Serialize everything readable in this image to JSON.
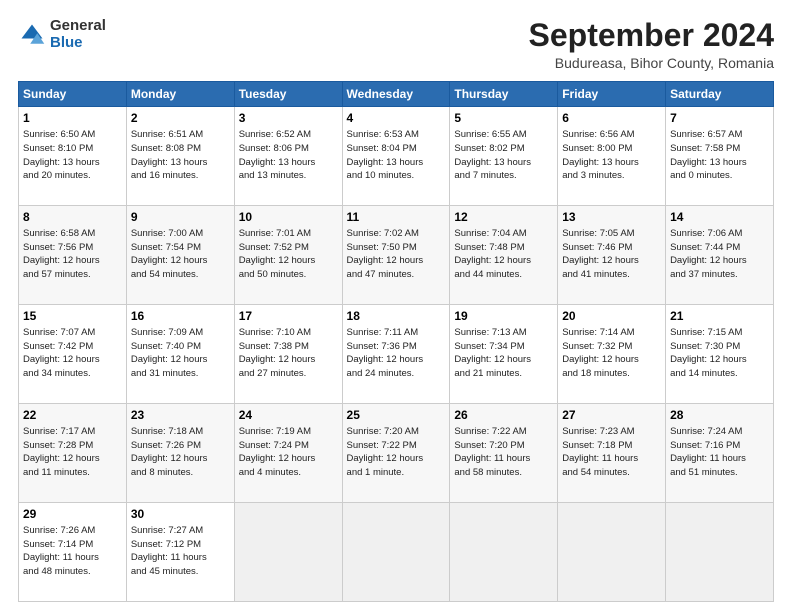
{
  "logo": {
    "general": "General",
    "blue": "Blue"
  },
  "title": "September 2024",
  "subtitle": "Budureasa, Bihor County, Romania",
  "days_header": [
    "Sunday",
    "Monday",
    "Tuesday",
    "Wednesday",
    "Thursday",
    "Friday",
    "Saturday"
  ],
  "weeks": [
    [
      {
        "day": "1",
        "info": "Sunrise: 6:50 AM\nSunset: 8:10 PM\nDaylight: 13 hours\nand 20 minutes."
      },
      {
        "day": "2",
        "info": "Sunrise: 6:51 AM\nSunset: 8:08 PM\nDaylight: 13 hours\nand 16 minutes."
      },
      {
        "day": "3",
        "info": "Sunrise: 6:52 AM\nSunset: 8:06 PM\nDaylight: 13 hours\nand 13 minutes."
      },
      {
        "day": "4",
        "info": "Sunrise: 6:53 AM\nSunset: 8:04 PM\nDaylight: 13 hours\nand 10 minutes."
      },
      {
        "day": "5",
        "info": "Sunrise: 6:55 AM\nSunset: 8:02 PM\nDaylight: 13 hours\nand 7 minutes."
      },
      {
        "day": "6",
        "info": "Sunrise: 6:56 AM\nSunset: 8:00 PM\nDaylight: 13 hours\nand 3 minutes."
      },
      {
        "day": "7",
        "info": "Sunrise: 6:57 AM\nSunset: 7:58 PM\nDaylight: 13 hours\nand 0 minutes."
      }
    ],
    [
      {
        "day": "8",
        "info": "Sunrise: 6:58 AM\nSunset: 7:56 PM\nDaylight: 12 hours\nand 57 minutes."
      },
      {
        "day": "9",
        "info": "Sunrise: 7:00 AM\nSunset: 7:54 PM\nDaylight: 12 hours\nand 54 minutes."
      },
      {
        "day": "10",
        "info": "Sunrise: 7:01 AM\nSunset: 7:52 PM\nDaylight: 12 hours\nand 50 minutes."
      },
      {
        "day": "11",
        "info": "Sunrise: 7:02 AM\nSunset: 7:50 PM\nDaylight: 12 hours\nand 47 minutes."
      },
      {
        "day": "12",
        "info": "Sunrise: 7:04 AM\nSunset: 7:48 PM\nDaylight: 12 hours\nand 44 minutes."
      },
      {
        "day": "13",
        "info": "Sunrise: 7:05 AM\nSunset: 7:46 PM\nDaylight: 12 hours\nand 41 minutes."
      },
      {
        "day": "14",
        "info": "Sunrise: 7:06 AM\nSunset: 7:44 PM\nDaylight: 12 hours\nand 37 minutes."
      }
    ],
    [
      {
        "day": "15",
        "info": "Sunrise: 7:07 AM\nSunset: 7:42 PM\nDaylight: 12 hours\nand 34 minutes."
      },
      {
        "day": "16",
        "info": "Sunrise: 7:09 AM\nSunset: 7:40 PM\nDaylight: 12 hours\nand 31 minutes."
      },
      {
        "day": "17",
        "info": "Sunrise: 7:10 AM\nSunset: 7:38 PM\nDaylight: 12 hours\nand 27 minutes."
      },
      {
        "day": "18",
        "info": "Sunrise: 7:11 AM\nSunset: 7:36 PM\nDaylight: 12 hours\nand 24 minutes."
      },
      {
        "day": "19",
        "info": "Sunrise: 7:13 AM\nSunset: 7:34 PM\nDaylight: 12 hours\nand 21 minutes."
      },
      {
        "day": "20",
        "info": "Sunrise: 7:14 AM\nSunset: 7:32 PM\nDaylight: 12 hours\nand 18 minutes."
      },
      {
        "day": "21",
        "info": "Sunrise: 7:15 AM\nSunset: 7:30 PM\nDaylight: 12 hours\nand 14 minutes."
      }
    ],
    [
      {
        "day": "22",
        "info": "Sunrise: 7:17 AM\nSunset: 7:28 PM\nDaylight: 12 hours\nand 11 minutes."
      },
      {
        "day": "23",
        "info": "Sunrise: 7:18 AM\nSunset: 7:26 PM\nDaylight: 12 hours\nand 8 minutes."
      },
      {
        "day": "24",
        "info": "Sunrise: 7:19 AM\nSunset: 7:24 PM\nDaylight: 12 hours\nand 4 minutes."
      },
      {
        "day": "25",
        "info": "Sunrise: 7:20 AM\nSunset: 7:22 PM\nDaylight: 12 hours\nand 1 minute."
      },
      {
        "day": "26",
        "info": "Sunrise: 7:22 AM\nSunset: 7:20 PM\nDaylight: 11 hours\nand 58 minutes."
      },
      {
        "day": "27",
        "info": "Sunrise: 7:23 AM\nSunset: 7:18 PM\nDaylight: 11 hours\nand 54 minutes."
      },
      {
        "day": "28",
        "info": "Sunrise: 7:24 AM\nSunset: 7:16 PM\nDaylight: 11 hours\nand 51 minutes."
      }
    ],
    [
      {
        "day": "29",
        "info": "Sunrise: 7:26 AM\nSunset: 7:14 PM\nDaylight: 11 hours\nand 48 minutes."
      },
      {
        "day": "30",
        "info": "Sunrise: 7:27 AM\nSunset: 7:12 PM\nDaylight: 11 hours\nand 45 minutes."
      },
      {
        "day": "",
        "info": ""
      },
      {
        "day": "",
        "info": ""
      },
      {
        "day": "",
        "info": ""
      },
      {
        "day": "",
        "info": ""
      },
      {
        "day": "",
        "info": ""
      }
    ]
  ]
}
